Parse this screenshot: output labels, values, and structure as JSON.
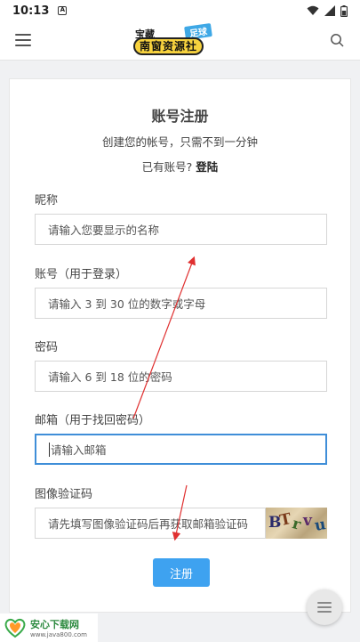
{
  "statusbar": {
    "time": "10:13",
    "a_icon": "A"
  },
  "header": {
    "logo_top": "宝藏",
    "logo_tag": "足球",
    "logo_main": "南窗资源社"
  },
  "form": {
    "title": "账号注册",
    "subtitle": "创建您的帐号，只需不到一分钟",
    "has_account": "已有账号?",
    "login_link": "登陆",
    "nickname_label": "昵称",
    "nickname_placeholder": "请输入您要显示的名称",
    "account_label": "账号（用于登录）",
    "account_placeholder": "请输入 3 到 30 位的数字或字母",
    "password_label": "密码",
    "password_placeholder": "请输入 6 到 18 位的密码",
    "email_label": "邮箱（用于找回密码）",
    "email_placeholder": "请输入邮箱",
    "captcha_label": "图像验证码",
    "captcha_placeholder": "请先填写图像验证码后再获取邮箱验证码",
    "captcha_chars": [
      "B",
      "T",
      "r",
      "v",
      "u"
    ],
    "submit_label": "注册"
  },
  "watermark": {
    "name": "安心下载网",
    "url": "www.java800.com"
  },
  "colors": {
    "accent": "#3ea2f0",
    "focus_border": "#3f8ed8",
    "arrow": "#e03030"
  }
}
